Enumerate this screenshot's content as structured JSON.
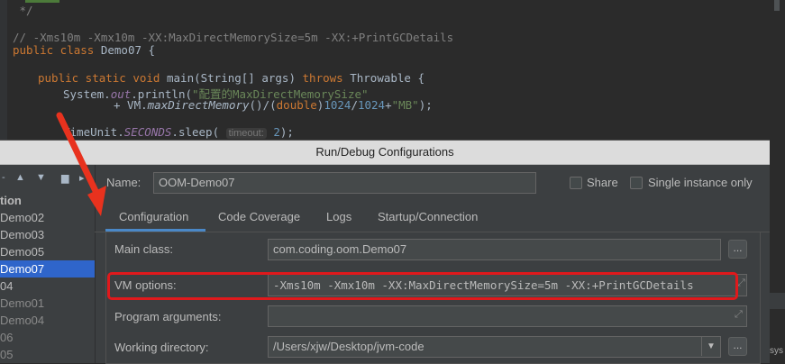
{
  "editor": {
    "lines": [
      {
        "text": " */"
      },
      {
        "text": "// -Xms10m -Xmx10m -XX:MaxDirectMemorySize=5m -XX:+PrintGCDetails"
      },
      {
        "kw1": "public class",
        "name": "Demo07 {"
      },
      {
        "kw1": "public static void",
        "rest": "main(String[] args)",
        "kw2": "throws",
        "rest2": "Throwable {"
      },
      {
        "pre": "System.",
        "out": "out",
        "mid": ".println(",
        "str": "\"配置的MaxDirectMemorySize\""
      },
      {
        "pre": "+ VM.",
        "fn": "maxDirectMemory",
        "p1": "()/(",
        "kw": "double",
        "p2": ")",
        "n1": "1024",
        "p3": "/",
        "n2": "1024",
        "p4": "+",
        "str": "\"MB\"",
        "end": ");"
      },
      {
        "pre": "TimeUnit.",
        "field": "SECONDS",
        "mid": ".sleep(",
        "hint": "timeout:",
        "num": "2",
        "end": ");"
      }
    ]
  },
  "dialog": {
    "title": "Run/Debug Configurations",
    "toolbar": {
      "remove": "-",
      "up": "▲",
      "down": "▼",
      "folder": "▆",
      "more": "▸"
    },
    "tree": [
      {
        "label": "tion",
        "state": "bold"
      },
      {
        "label": "Demo02",
        "state": "normal"
      },
      {
        "label": "Demo03",
        "state": "normal"
      },
      {
        "label": "Demo05",
        "state": "normal"
      },
      {
        "label": "Demo07",
        "state": "selected"
      },
      {
        "label": "04",
        "state": "normal"
      },
      {
        "label": "Demo01",
        "state": "dim"
      },
      {
        "label": "Demo04",
        "state": "dim"
      },
      {
        "label": "06",
        "state": "dim"
      },
      {
        "label": "05",
        "state": "dim"
      }
    ],
    "name_label": "Name:",
    "name_value": "OOM-Demo07",
    "share_label": "Share",
    "single_instance_label": "Single instance only",
    "tabs": [
      "Configuration",
      "Code Coverage",
      "Logs",
      "Startup/Connection"
    ],
    "active_tab": "Configuration",
    "fields": {
      "main_class_label": "Main class:",
      "main_class_value": "com.coding.oom.Demo07",
      "vm_options_label": "VM options:",
      "vm_options_value": "-Xms10m -Xmx10m -XX:MaxDirectMemorySize=5m -XX:+PrintGCDetails",
      "program_args_label": "Program arguments:",
      "program_args_value": "",
      "working_dir_label": "Working directory:",
      "working_dir_value": "/Users/xjw/Desktop/jvm-code"
    },
    "browse_label": "...",
    "expand_icon": "⤢",
    "dropdown_icon": "▼"
  },
  "annotation": {
    "arrow_color": "#e8321e",
    "highlight_color": "#e0191c"
  },
  "right_edge_text": "sys"
}
